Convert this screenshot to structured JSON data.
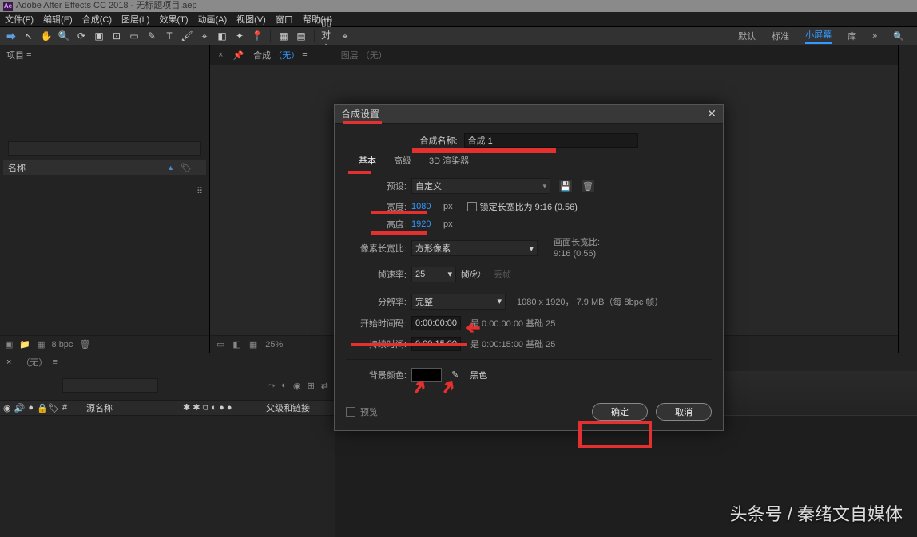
{
  "titlebar": {
    "app": "Adobe After Effects CC 2018 - 无标题项目.aep"
  },
  "menu": {
    "file": "文件(F)",
    "edit": "编辑(E)",
    "comp": "合成(C)",
    "layer": "图层(L)",
    "effect": "效果(T)",
    "anim": "动画(A)",
    "view": "视图(V)",
    "window": "窗口",
    "help": "帮助(H)"
  },
  "workspaces": {
    "default": "默认",
    "standard": "标准",
    "small": "小屏幕",
    "lib": "库"
  },
  "projectPanel": {
    "tab": "项目 ≡",
    "search_placeholder": "",
    "name_header": "名称",
    "bpc": "8 bpc"
  },
  "viewer": {
    "tab_prefix": "合成",
    "tab_none": "（无）",
    "layer_tab": "图层 （无）",
    "zoom": "25%"
  },
  "timeline": {
    "tab_none": "（无）",
    "eye": "●",
    "col_source": "源名称",
    "col_parent": "父级和链接"
  },
  "dialog": {
    "title": "合成设置",
    "name_label": "合成名称:",
    "name_value": "合成 1",
    "tabs": {
      "basic": "基本",
      "advanced": "高级",
      "renderer": "3D 渲染器"
    },
    "preset_label": "预设:",
    "preset_value": "自定义",
    "width_label": "宽度:",
    "width_value": "1080",
    "height_label": "高度:",
    "height_value": "1920",
    "px": "px",
    "lock_label": "锁定长宽比为 9:16 (0.56)",
    "par_label": "像素长宽比:",
    "par_value": "方形像素",
    "far_label": "画面长宽比:",
    "far_value": "9:16 (0.56)",
    "fps_label": "帧速率:",
    "fps_value": "25",
    "fps_unit": "帧/秒",
    "fps_drop": "丢帧",
    "res_label": "分辨率:",
    "res_value": "完整",
    "res_info": "1080 x 1920， 7.9 MB（每 8bpc 帧）",
    "start_label": "开始时间码:",
    "start_value": "0:00:00:00",
    "start_suffix": "是 0:00:00:00 基础 25",
    "dur_label": "持续时间:",
    "dur_value": "0:00:15:00",
    "dur_suffix": "是 0:00:15:00 基础 25",
    "bg_label": "背景颜色:",
    "bg_name": "黑色",
    "preview": "预览",
    "ok": "确定",
    "cancel": "取消"
  },
  "watermark": "头条号 / 秦绪文自媒体"
}
